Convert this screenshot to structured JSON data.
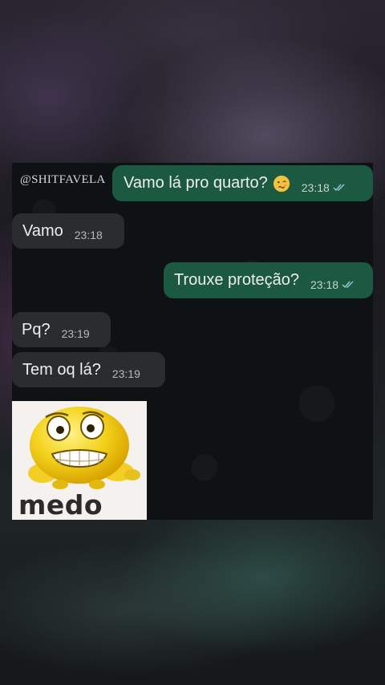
{
  "watermark": "@SHITFAVELA",
  "messages": [
    {
      "direction": "outgoing",
      "text": "Vamo lá pro quarto?",
      "emoji": "woozy-face",
      "time": "23:18",
      "status": "read"
    },
    {
      "direction": "incoming",
      "text": "Vamo",
      "time": "23:18"
    },
    {
      "direction": "outgoing",
      "text": "Trouxe proteção?",
      "time": "23:18",
      "status": "read"
    },
    {
      "direction": "incoming",
      "text": "Pq?",
      "time": "23:19"
    },
    {
      "direction": "incoming",
      "text": "Tem oq lá?",
      "time": "23:19"
    }
  ],
  "sticker": {
    "icon": "scared-emoji-sticker",
    "caption": "medo"
  },
  "colors": {
    "outgoing_bubble": "#1b5a40",
    "incoming_bubble": "#2a2c30",
    "chat_background": "#0e1214",
    "read_ticks": "#9fc6d6"
  }
}
